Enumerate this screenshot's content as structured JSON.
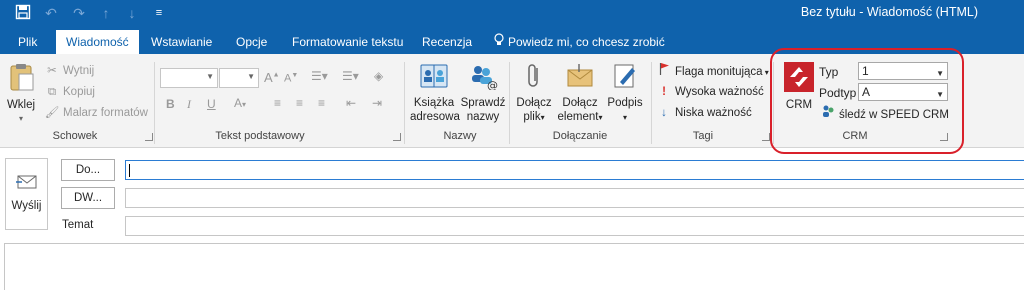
{
  "window": {
    "title": "Bez tytułu - Wiadomość (HTML)"
  },
  "quick_access": {
    "save_icon": "save-icon",
    "undo_icon": "undo-icon",
    "redo_icon": "redo-icon",
    "up_icon": "arrow-up-icon",
    "down_icon": "arrow-down-icon",
    "customize_icon": "customize-icon"
  },
  "tabs": [
    {
      "label": "Plik"
    },
    {
      "label": "Wiadomość"
    },
    {
      "label": "Wstawianie"
    },
    {
      "label": "Opcje"
    },
    {
      "label": "Formatowanie tekstu"
    },
    {
      "label": "Recenzja"
    },
    {
      "label": "Powiedz mi, co chcesz zrobić"
    }
  ],
  "ribbon": {
    "clipboard": {
      "paste_label": "Wklej",
      "cut_label": "Wytnij",
      "copy_label": "Kopiuj",
      "format_painter_label": "Malarz formatów",
      "group_label": "Schowek"
    },
    "basic_text": {
      "font_value": "",
      "size_value": "",
      "bold": "B",
      "italic": "I",
      "underline": "U",
      "font_color": "A",
      "grow": "A",
      "shrink": "A",
      "group_label": "Tekst podstawowy"
    },
    "names": {
      "address_book_line1": "Książka",
      "address_book_line2": "adresowa",
      "check_names_line1": "Sprawdź",
      "check_names_line2": "nazwy",
      "group_label": "Nazwy"
    },
    "include": {
      "attach_file_line1": "Dołącz",
      "attach_file_line2": "plik",
      "attach_item_line1": "Dołącz",
      "attach_item_line2": "element",
      "signature_label": "Podpis",
      "group_label": "Dołączanie"
    },
    "tags": {
      "follow_up_label": "Flaga monitująca",
      "high_importance_label": "Wysoka ważność",
      "low_importance_label": "Niska ważność",
      "group_label": "Tagi"
    },
    "crm": {
      "crm_label": "CRM",
      "type_label": "Typ",
      "type_value": "1",
      "subtype_label": "Podtyp",
      "subtype_value": "A",
      "track_label": "śledź w SPEED CRM",
      "group_label": "CRM",
      "highlight_color": "#d9202a",
      "logo_color": "#c8242b"
    }
  },
  "compose": {
    "send_label": "Wyślij",
    "to_button": "Do...",
    "cc_button": "DW...",
    "subject_label": "Temat",
    "to_value": "",
    "cc_value": "",
    "subject_value": ""
  },
  "colors": {
    "accent": "#0f62ac",
    "ribbon_bg": "#f3f3f3"
  }
}
